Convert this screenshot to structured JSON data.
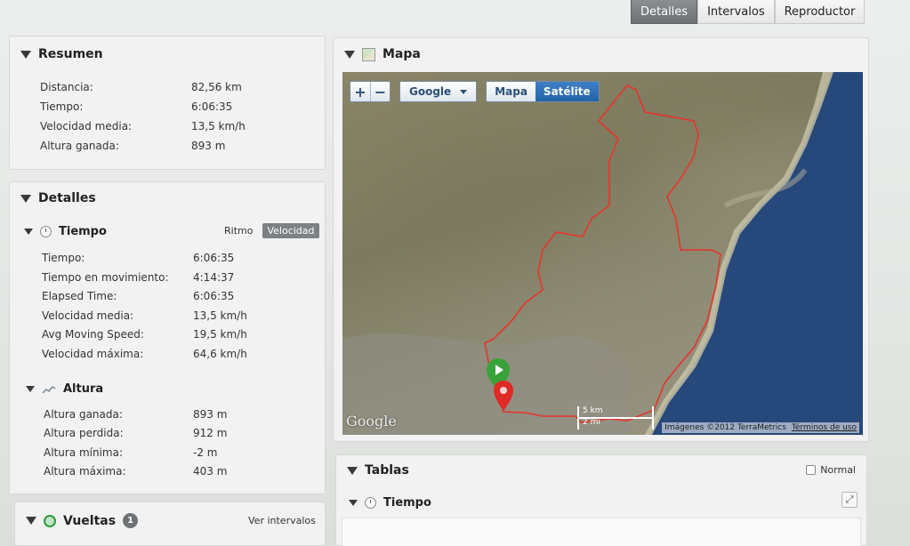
{
  "top_tabs": [
    {
      "label": "Detalles",
      "active": true
    },
    {
      "label": "Intervalos",
      "active": false
    },
    {
      "label": "Reproductor",
      "active": false
    }
  ],
  "resumen": {
    "title": "Resumen",
    "rows": [
      {
        "label": "Distancia:",
        "value": "82,56 km"
      },
      {
        "label": "Tiempo:",
        "value": "6:06:35"
      },
      {
        "label": "Velocidad media:",
        "value": "13,5 km/h"
      },
      {
        "label": "Altura ganada:",
        "value": "893 m"
      }
    ]
  },
  "detalles": {
    "title": "Detalles",
    "tiempo": {
      "title": "Tiempo",
      "toggle": {
        "ritmo": "Ritmo",
        "velocidad": "Velocidad",
        "selected": "Velocidad"
      },
      "rows": [
        {
          "label": "Tiempo:",
          "value": "6:06:35"
        },
        {
          "label": "Tiempo en movimiento:",
          "value": "4:14:37"
        },
        {
          "label": "Elapsed Time:",
          "value": "6:06:35"
        },
        {
          "label": "Velocidad media:",
          "value": "13,5 km/h"
        },
        {
          "label": "Avg Moving Speed:",
          "value": "19,5 km/h"
        },
        {
          "label": "Velocidad máxima:",
          "value": "64,6 km/h"
        }
      ]
    },
    "altura": {
      "title": "Altura",
      "rows": [
        {
          "label": "Altura ganada:",
          "value": "893 m"
        },
        {
          "label": "Altura perdida:",
          "value": "912 m"
        },
        {
          "label": "Altura mínima:",
          "value": "-2 m"
        },
        {
          "label": "Altura máxima:",
          "value": "403 m"
        }
      ]
    }
  },
  "vueltas": {
    "title": "Vueltas",
    "count": "1",
    "link": "Ver intervalos"
  },
  "mapa": {
    "title": "Mapa",
    "zoom_in": "+",
    "zoom_out": "−",
    "provider": "Google",
    "map_types": [
      {
        "label": "Mapa",
        "active": false
      },
      {
        "label": "Satélite",
        "active": true
      }
    ],
    "logo": "Google",
    "scale_km": "5 km",
    "scale_mi": "2 mi",
    "copyright": "Imágenes ©2012 TerraMetrics",
    "terms": "Términos de uso",
    "route_color": "#e8332a",
    "start_marker_color": "#3aa23a",
    "end_marker_color": "#e02a25"
  },
  "tablas": {
    "title": "Tablas",
    "normal_label": "Normal",
    "tiempo_title": "Tiempo"
  }
}
